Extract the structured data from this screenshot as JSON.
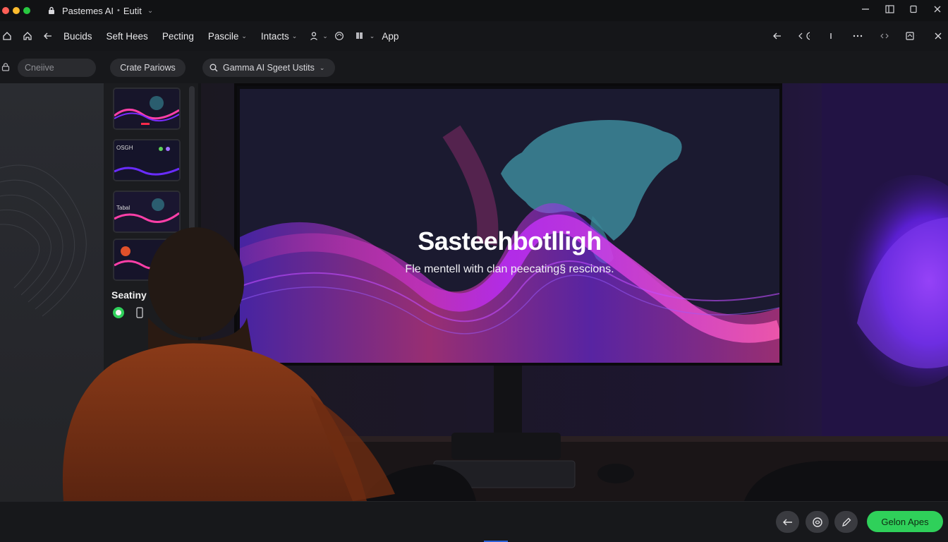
{
  "titlebar": {
    "title": "Pastemes AI",
    "separator": "•",
    "edit_label": "Eutit",
    "caret": "⌄"
  },
  "menubar": {
    "items": [
      {
        "label": "Bucids",
        "has_caret": false
      },
      {
        "label": "Seft Hees",
        "has_caret": false
      },
      {
        "label": "Pecting",
        "has_caret": false
      },
      {
        "label": "Pascile",
        "has_caret": true
      },
      {
        "label": "Intacts",
        "has_caret": true
      }
    ],
    "app_label": "App",
    "caret_glyph": "⌄"
  },
  "toolbar": {
    "search_placeholder": "Cneiive",
    "create_label": "Crate Pariows",
    "gamma_label": "Gamma AI Sgeet Ustits",
    "gamma_caret": "⌄"
  },
  "filmstrip": {
    "thumb_titles": [
      "",
      "OSGH",
      "Tabal",
      ""
    ],
    "section_title": "Seatiny"
  },
  "slide": {
    "title": "Sasteehbotlligh",
    "subtitle": "Fle mentell with clan peecating§ rescions."
  },
  "bottombar": {
    "primary_button": "Gelon Apes"
  },
  "colors": {
    "accent_green": "#2fd05a",
    "wave_pink": "#ff3fa8",
    "wave_purple": "#6a2cff",
    "map_teal": "#4aa5b5",
    "bottom_indicator": "#2d62d8"
  },
  "icons": [
    "lock-icon",
    "home-icon",
    "back-arrow-icon",
    "person-icon",
    "globe-icon",
    "flag-icon",
    "search-icon",
    "minimize-icon",
    "sidebar-icon",
    "restore-icon",
    "close-icon",
    "more-icon",
    "code-icon",
    "share-icon",
    "info-icon",
    "pen-icon"
  ]
}
